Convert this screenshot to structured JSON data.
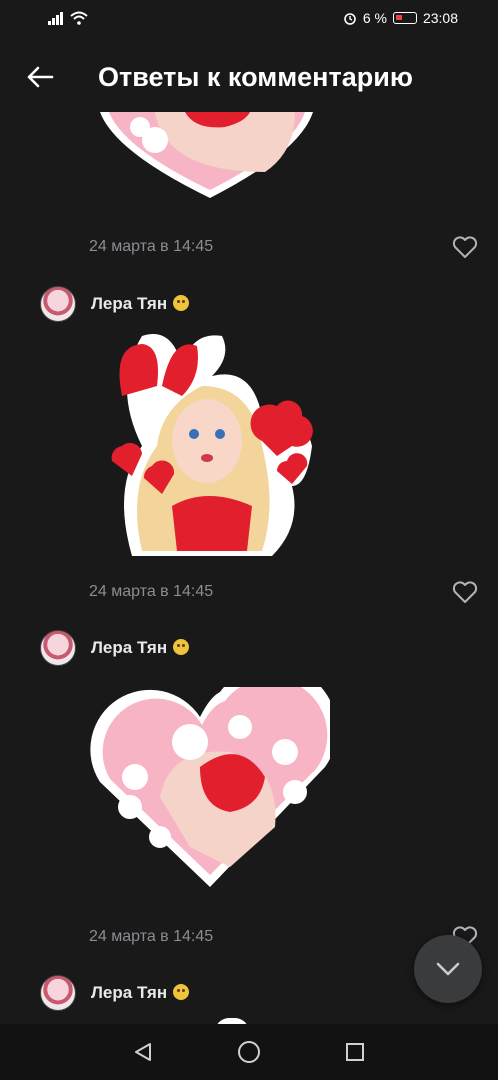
{
  "status_bar": {
    "alarm_icon": "alarm-icon",
    "battery_percent": "6 %",
    "time": "23:08"
  },
  "header": {
    "title": "Ответы к комментарию",
    "back_icon": "arrow-left-icon"
  },
  "comments": [
    {
      "author": "",
      "timestamp": "24 марта в 14:45",
      "sticker": "heart-bunny-sticker"
    },
    {
      "author": "Лера Тян",
      "emoji": "cat-emoji",
      "timestamp": "24 марта в 14:45",
      "sticker": "girl-bunny-ears-sticker"
    },
    {
      "author": "Лера Тян",
      "emoji": "cat-emoji",
      "timestamp": "24 марта в 14:45",
      "sticker": "heart-bunny-sticker"
    },
    {
      "author": "Лера Тян",
      "emoji": "cat-emoji"
    }
  ],
  "colors": {
    "background": "#19191a",
    "sticker_red": "#e21f2c",
    "sticker_pink": "#f7b4c4"
  }
}
